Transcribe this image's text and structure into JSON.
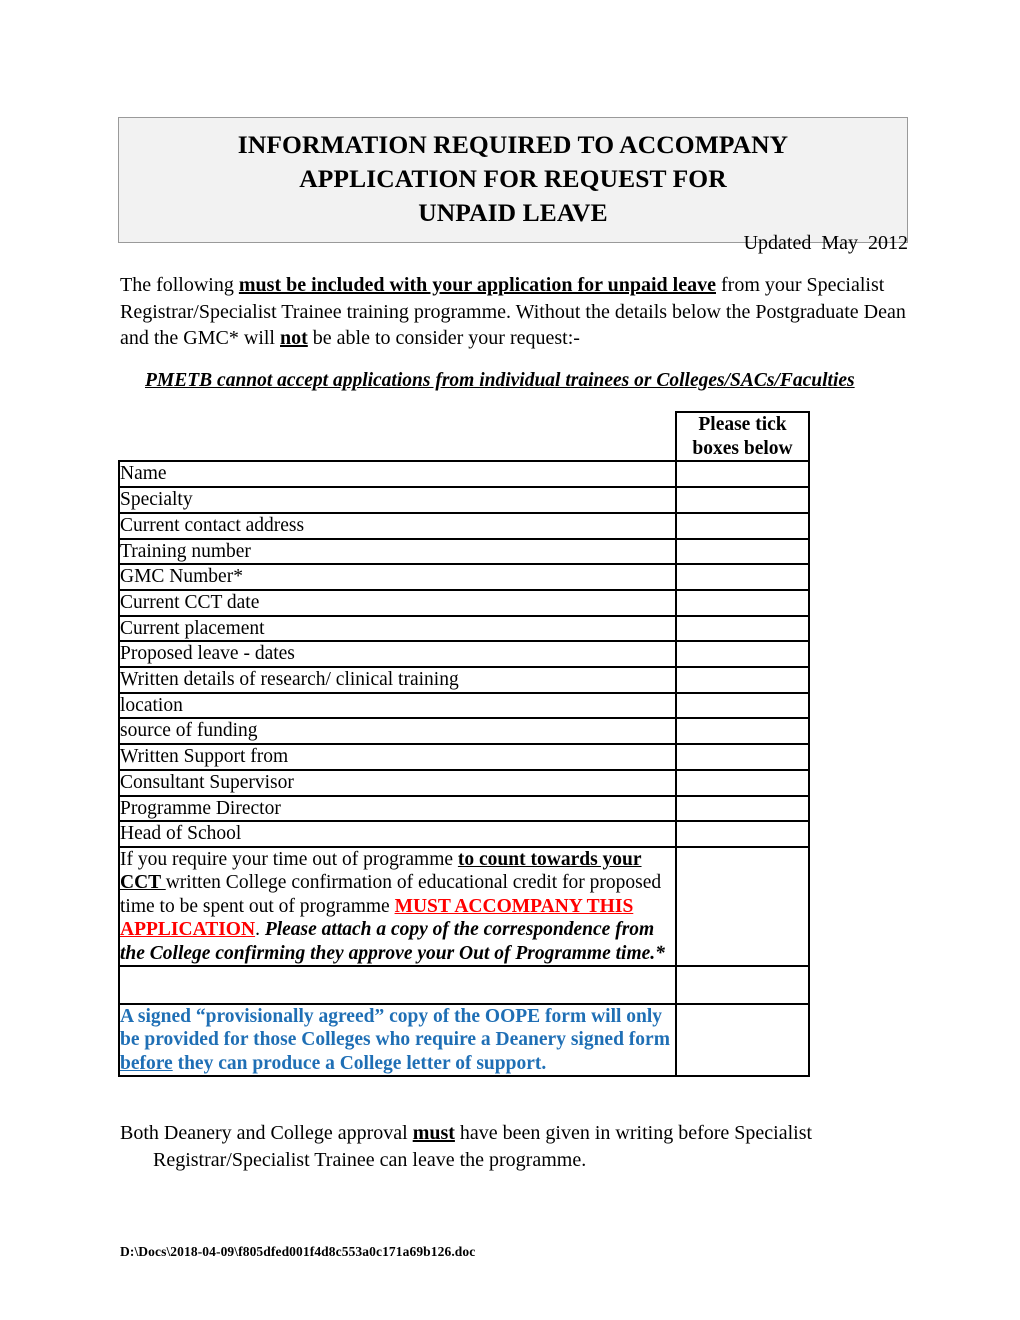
{
  "document": {
    "title_lines": [
      "INFORMATION REQUIRED TO ACCOMPANY",
      "APPLICATION FOR REQUEST FOR",
      "UNPAID LEAVE"
    ],
    "updated": "Updated  May  2012",
    "intro": {
      "part1": "The following ",
      "bold1": "must be included with your application for unpaid leave",
      "part2": " from your Specialist Registrar/Specialist Trainee training programme.  Without the details below the Postgraduate Dean and the GMC* will ",
      "bold2": "not",
      "part3": " be able to consider your request:-"
    },
    "notice": "PMETB cannot accept applications from individual trainees or Colleges/SACs/Faculties",
    "closing": {
      "part1": "Both Deanery and College approval ",
      "bold1": "must",
      "part2": " have been given in writing before Specialist",
      "line2": "Registrar/Specialist Trainee can leave the programme."
    },
    "footer_path": "D:\\Docs\\2018-04-09\\f805dfed001f4d8c553a0c171a69b126.doc"
  },
  "table": {
    "tick_header": "Please tick boxes below",
    "rows": [
      {
        "label": "Name",
        "indent": false
      },
      {
        "label": "Specialty",
        "indent": false
      },
      {
        "label": "Current contact address",
        "indent": false
      },
      {
        "label": "Training number",
        "indent": false
      },
      {
        "label": "GMC Number*",
        "indent": false
      },
      {
        "label": "Current CCT date",
        "indent": false
      },
      {
        "label": "Current placement",
        "indent": false
      },
      {
        "label": "Proposed leave  -  dates",
        "indent": false
      },
      {
        "label": "Written details of research/ clinical training",
        "indent": true
      },
      {
        "label": "location",
        "indent": true
      },
      {
        "label": "source of funding",
        "indent": true
      },
      {
        "label": "Written Support from",
        "indent": false
      },
      {
        "label": "Consultant Supervisor",
        "indent": true
      },
      {
        "label": "Programme Director",
        "indent": true
      },
      {
        "label": "Head of School",
        "indent": true
      }
    ],
    "cct_paragraph": {
      "part1": "If you require your time out of programme ",
      "bold_underline1": "to count towards your CCT ",
      "part2": "written College confirmation of educational credit for proposed time to be spent out of programme ",
      "red1": "MUST ACCOMPANY THIS",
      "red_space": " ",
      "red2": "APPLICATION",
      "part3": ".  ",
      "bold_italic": "Please attach a copy of the correspondence from the College confirming they approve your Out of Programme time.*"
    },
    "oope_paragraph": {
      "part1": "A  signed “provisionally agreed” copy of the OOPE form will only be provided for those Colleges who require a Deanery signed form",
      "underline": " before",
      "part2": " they can produce a College letter of support."
    }
  },
  "colors": {
    "red": "#ff0000",
    "blue": "#1f6fb5",
    "title_box_bg": "#f2f2f2",
    "title_box_border": "#9a9a9a"
  }
}
